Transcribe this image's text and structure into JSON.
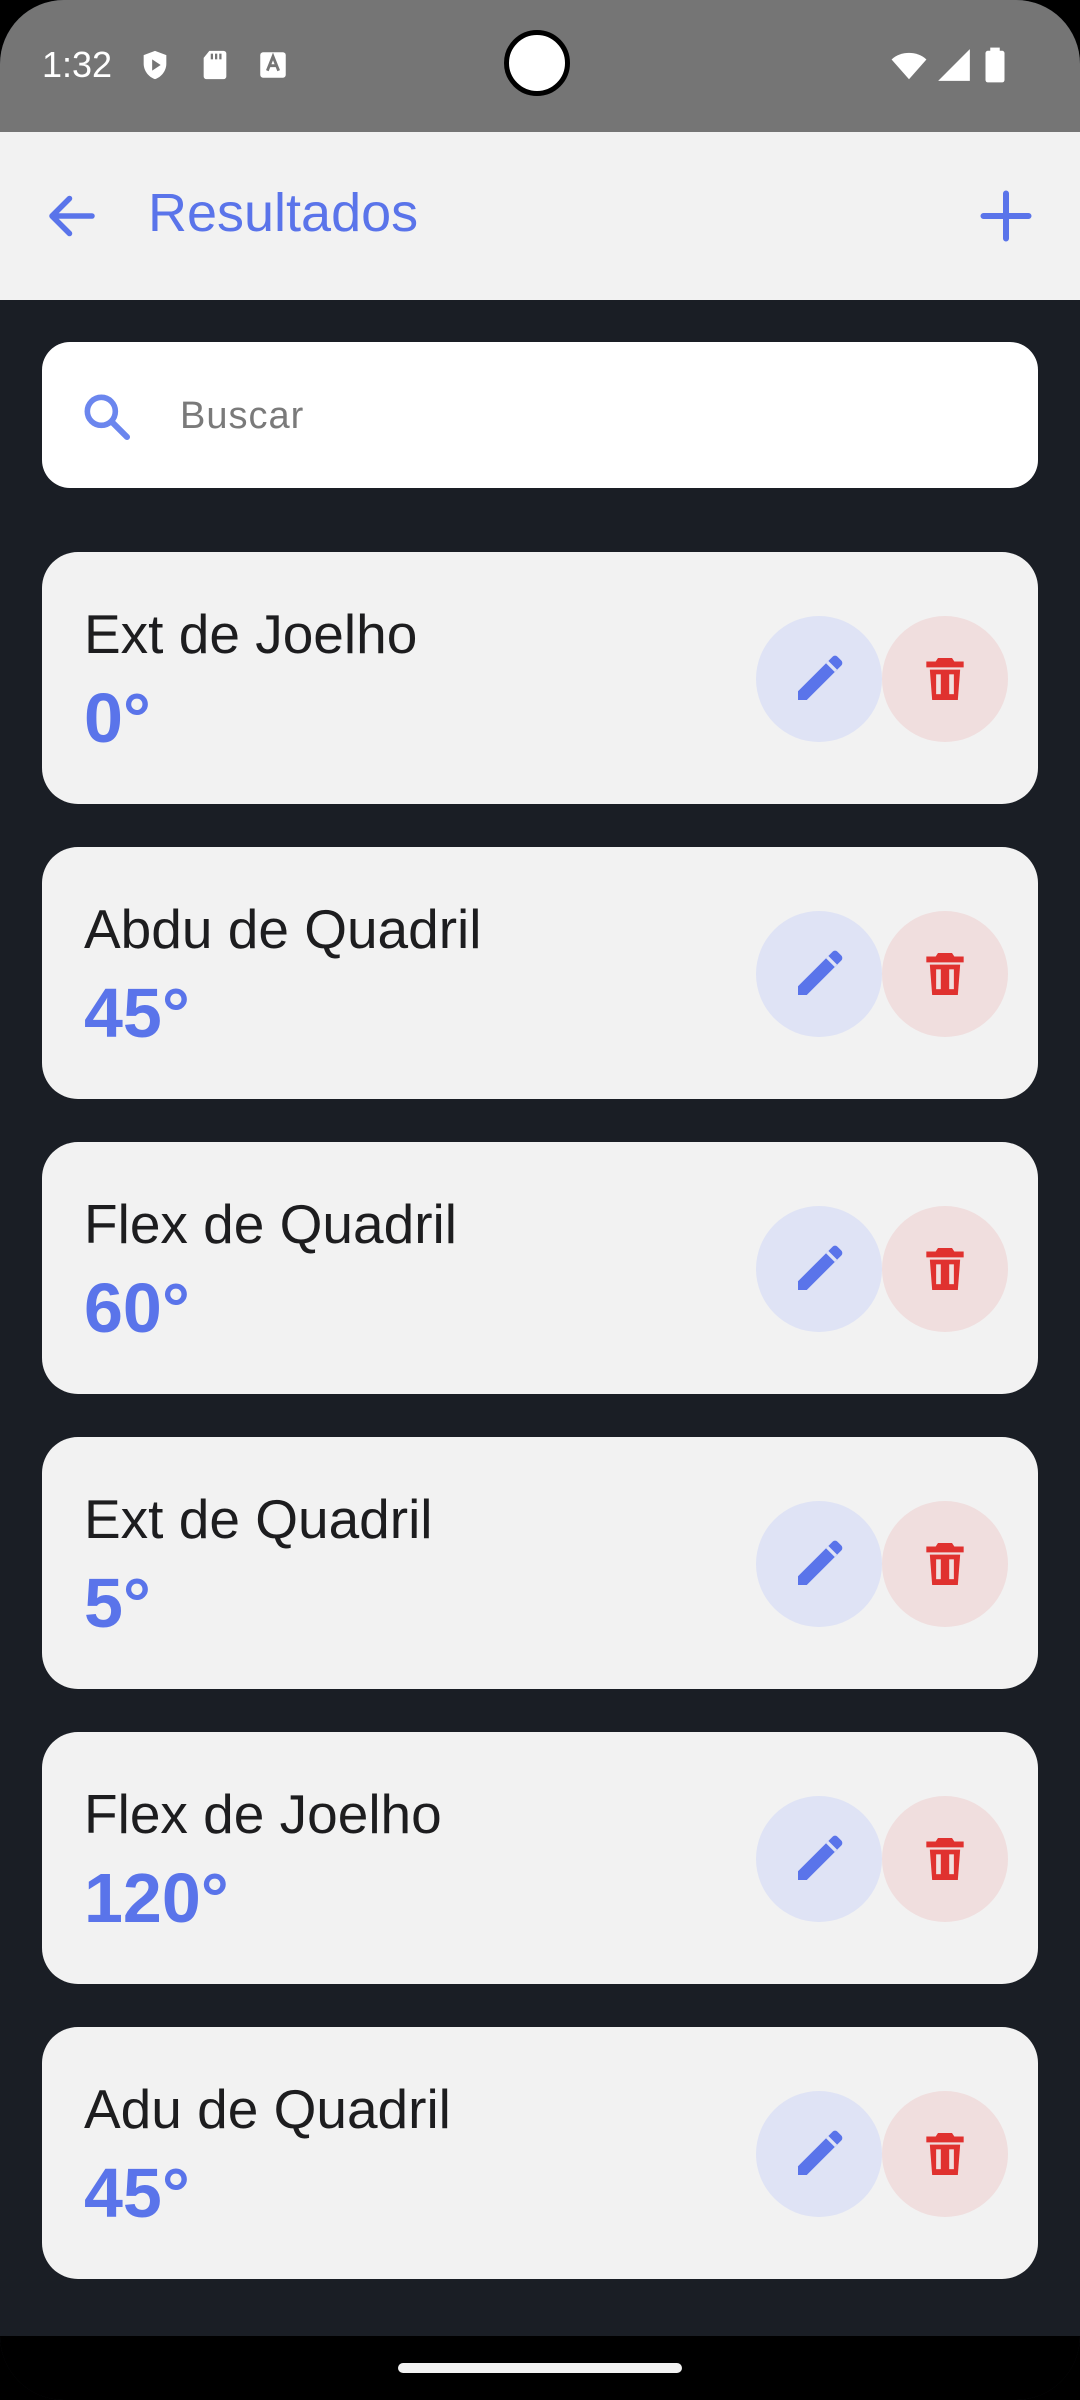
{
  "status_bar": {
    "time": "1:32",
    "left_icons": [
      "shield-icon",
      "sd-card-icon",
      "keyboard-a-icon"
    ],
    "right_icons": [
      "wifi-icon",
      "signal-icon",
      "battery-icon"
    ]
  },
  "app_bar": {
    "title": "Resultados",
    "back_icon": "arrow-left-icon",
    "add_icon": "plus-icon"
  },
  "search": {
    "placeholder": "Buscar",
    "value": ""
  },
  "items": [
    {
      "name": "Ext de Joelho",
      "value": "0°"
    },
    {
      "name": "Abdu de Quadril",
      "value": "45°"
    },
    {
      "name": "Flex de Quadril",
      "value": "60°"
    },
    {
      "name": "Ext de Quadril",
      "value": "5°"
    },
    {
      "name": "Flex de Joelho",
      "value": "120°"
    },
    {
      "name": "Adu de Quadril",
      "value": "45°"
    }
  ],
  "colors": {
    "accent": "#5a74ea",
    "delete": "#e0312f",
    "background": "#1a1e25",
    "card": "#f2f2f2",
    "status_bar": "#757575"
  }
}
